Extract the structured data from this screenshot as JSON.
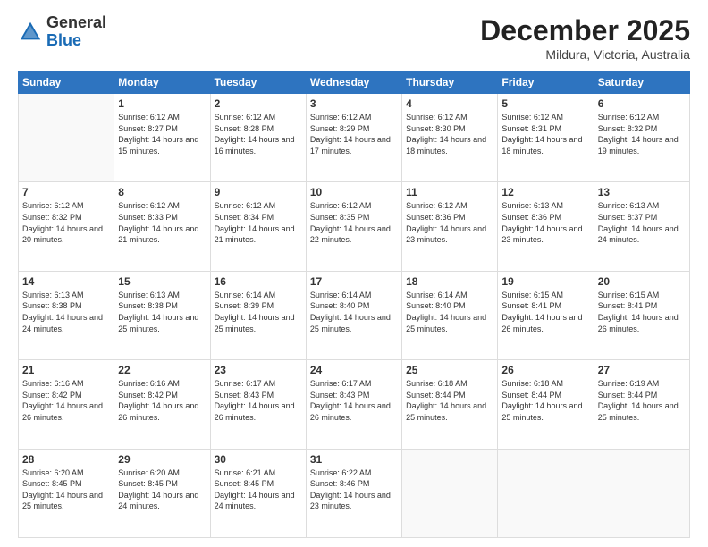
{
  "logo": {
    "general": "General",
    "blue": "Blue"
  },
  "header": {
    "month": "December 2025",
    "location": "Mildura, Victoria, Australia"
  },
  "weekdays": [
    "Sunday",
    "Monday",
    "Tuesday",
    "Wednesday",
    "Thursday",
    "Friday",
    "Saturday"
  ],
  "weeks": [
    [
      {
        "day": "",
        "sunrise": "",
        "sunset": "",
        "daylight": ""
      },
      {
        "day": "1",
        "sunrise": "Sunrise: 6:12 AM",
        "sunset": "Sunset: 8:27 PM",
        "daylight": "Daylight: 14 hours and 15 minutes."
      },
      {
        "day": "2",
        "sunrise": "Sunrise: 6:12 AM",
        "sunset": "Sunset: 8:28 PM",
        "daylight": "Daylight: 14 hours and 16 minutes."
      },
      {
        "day": "3",
        "sunrise": "Sunrise: 6:12 AM",
        "sunset": "Sunset: 8:29 PM",
        "daylight": "Daylight: 14 hours and 17 minutes."
      },
      {
        "day": "4",
        "sunrise": "Sunrise: 6:12 AM",
        "sunset": "Sunset: 8:30 PM",
        "daylight": "Daylight: 14 hours and 18 minutes."
      },
      {
        "day": "5",
        "sunrise": "Sunrise: 6:12 AM",
        "sunset": "Sunset: 8:31 PM",
        "daylight": "Daylight: 14 hours and 18 minutes."
      },
      {
        "day": "6",
        "sunrise": "Sunrise: 6:12 AM",
        "sunset": "Sunset: 8:32 PM",
        "daylight": "Daylight: 14 hours and 19 minutes."
      }
    ],
    [
      {
        "day": "7",
        "sunrise": "Sunrise: 6:12 AM",
        "sunset": "Sunset: 8:32 PM",
        "daylight": "Daylight: 14 hours and 20 minutes."
      },
      {
        "day": "8",
        "sunrise": "Sunrise: 6:12 AM",
        "sunset": "Sunset: 8:33 PM",
        "daylight": "Daylight: 14 hours and 21 minutes."
      },
      {
        "day": "9",
        "sunrise": "Sunrise: 6:12 AM",
        "sunset": "Sunset: 8:34 PM",
        "daylight": "Daylight: 14 hours and 21 minutes."
      },
      {
        "day": "10",
        "sunrise": "Sunrise: 6:12 AM",
        "sunset": "Sunset: 8:35 PM",
        "daylight": "Daylight: 14 hours and 22 minutes."
      },
      {
        "day": "11",
        "sunrise": "Sunrise: 6:12 AM",
        "sunset": "Sunset: 8:36 PM",
        "daylight": "Daylight: 14 hours and 23 minutes."
      },
      {
        "day": "12",
        "sunrise": "Sunrise: 6:13 AM",
        "sunset": "Sunset: 8:36 PM",
        "daylight": "Daylight: 14 hours and 23 minutes."
      },
      {
        "day": "13",
        "sunrise": "Sunrise: 6:13 AM",
        "sunset": "Sunset: 8:37 PM",
        "daylight": "Daylight: 14 hours and 24 minutes."
      }
    ],
    [
      {
        "day": "14",
        "sunrise": "Sunrise: 6:13 AM",
        "sunset": "Sunset: 8:38 PM",
        "daylight": "Daylight: 14 hours and 24 minutes."
      },
      {
        "day": "15",
        "sunrise": "Sunrise: 6:13 AM",
        "sunset": "Sunset: 8:38 PM",
        "daylight": "Daylight: 14 hours and 25 minutes."
      },
      {
        "day": "16",
        "sunrise": "Sunrise: 6:14 AM",
        "sunset": "Sunset: 8:39 PM",
        "daylight": "Daylight: 14 hours and 25 minutes."
      },
      {
        "day": "17",
        "sunrise": "Sunrise: 6:14 AM",
        "sunset": "Sunset: 8:40 PM",
        "daylight": "Daylight: 14 hours and 25 minutes."
      },
      {
        "day": "18",
        "sunrise": "Sunrise: 6:14 AM",
        "sunset": "Sunset: 8:40 PM",
        "daylight": "Daylight: 14 hours and 25 minutes."
      },
      {
        "day": "19",
        "sunrise": "Sunrise: 6:15 AM",
        "sunset": "Sunset: 8:41 PM",
        "daylight": "Daylight: 14 hours and 26 minutes."
      },
      {
        "day": "20",
        "sunrise": "Sunrise: 6:15 AM",
        "sunset": "Sunset: 8:41 PM",
        "daylight": "Daylight: 14 hours and 26 minutes."
      }
    ],
    [
      {
        "day": "21",
        "sunrise": "Sunrise: 6:16 AM",
        "sunset": "Sunset: 8:42 PM",
        "daylight": "Daylight: 14 hours and 26 minutes."
      },
      {
        "day": "22",
        "sunrise": "Sunrise: 6:16 AM",
        "sunset": "Sunset: 8:42 PM",
        "daylight": "Daylight: 14 hours and 26 minutes."
      },
      {
        "day": "23",
        "sunrise": "Sunrise: 6:17 AM",
        "sunset": "Sunset: 8:43 PM",
        "daylight": "Daylight: 14 hours and 26 minutes."
      },
      {
        "day": "24",
        "sunrise": "Sunrise: 6:17 AM",
        "sunset": "Sunset: 8:43 PM",
        "daylight": "Daylight: 14 hours and 26 minutes."
      },
      {
        "day": "25",
        "sunrise": "Sunrise: 6:18 AM",
        "sunset": "Sunset: 8:44 PM",
        "daylight": "Daylight: 14 hours and 25 minutes."
      },
      {
        "day": "26",
        "sunrise": "Sunrise: 6:18 AM",
        "sunset": "Sunset: 8:44 PM",
        "daylight": "Daylight: 14 hours and 25 minutes."
      },
      {
        "day": "27",
        "sunrise": "Sunrise: 6:19 AM",
        "sunset": "Sunset: 8:44 PM",
        "daylight": "Daylight: 14 hours and 25 minutes."
      }
    ],
    [
      {
        "day": "28",
        "sunrise": "Sunrise: 6:20 AM",
        "sunset": "Sunset: 8:45 PM",
        "daylight": "Daylight: 14 hours and 25 minutes."
      },
      {
        "day": "29",
        "sunrise": "Sunrise: 6:20 AM",
        "sunset": "Sunset: 8:45 PM",
        "daylight": "Daylight: 14 hours and 24 minutes."
      },
      {
        "day": "30",
        "sunrise": "Sunrise: 6:21 AM",
        "sunset": "Sunset: 8:45 PM",
        "daylight": "Daylight: 14 hours and 24 minutes."
      },
      {
        "day": "31",
        "sunrise": "Sunrise: 6:22 AM",
        "sunset": "Sunset: 8:46 PM",
        "daylight": "Daylight: 14 hours and 23 minutes."
      },
      {
        "day": "",
        "sunrise": "",
        "sunset": "",
        "daylight": ""
      },
      {
        "day": "",
        "sunrise": "",
        "sunset": "",
        "daylight": ""
      },
      {
        "day": "",
        "sunrise": "",
        "sunset": "",
        "daylight": ""
      }
    ]
  ]
}
